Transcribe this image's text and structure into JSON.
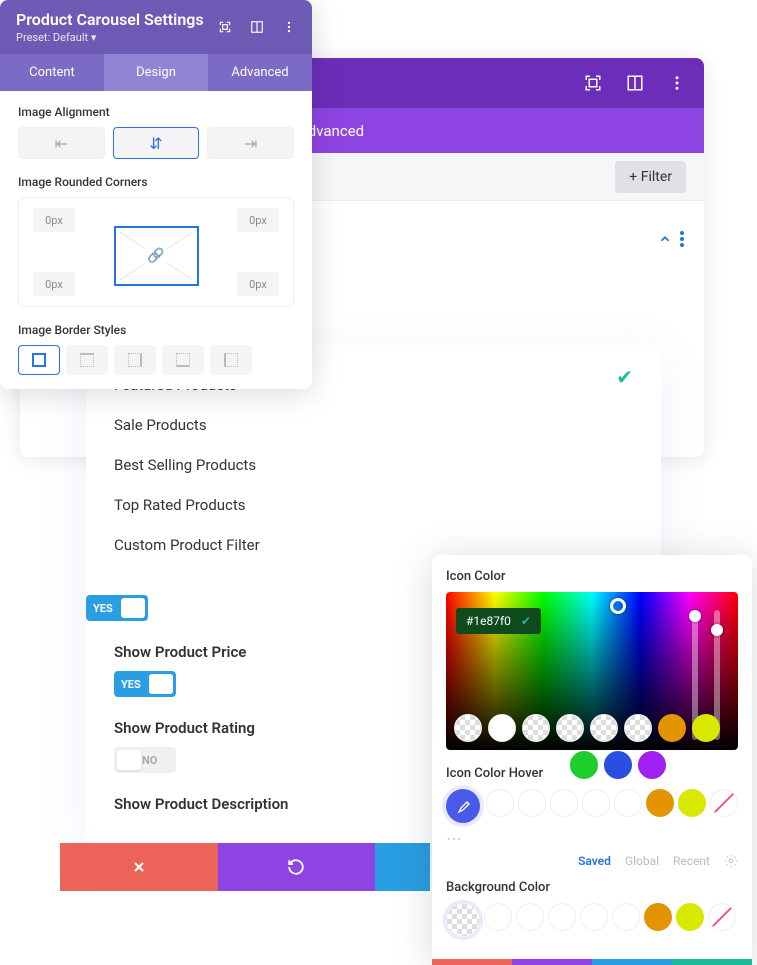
{
  "front": {
    "title": "Product Carousel Settings",
    "preset": "Preset: Default",
    "tabs": [
      "Content",
      "Design",
      "Advanced"
    ],
    "sections": {
      "alignment": "Image Alignment",
      "corners": "Image Rounded Corners",
      "borders": "Image Border Styles"
    },
    "corner_val": "0px"
  },
  "bg": {
    "tab_visible": "Advanced",
    "filter": "Filter"
  },
  "mid": {
    "items": [
      "Featured Products",
      "Sale Products",
      "Best Selling Products",
      "Top Rated Products",
      "Custom Product Filter"
    ],
    "toggles": {
      "price": {
        "label": "Show Product Price",
        "on": "YES"
      },
      "rating": {
        "label": "Show Product Rating",
        "off": "NO"
      },
      "desc": {
        "label": "Show Product Description"
      }
    },
    "yes": "YES",
    "no": "NO"
  },
  "cp": {
    "icon_color": "Icon Color",
    "icon_color_hover": "Icon Color Hover",
    "bg_color": "Background Color",
    "hex": "#1e87f0",
    "tabs": [
      "Saved",
      "Global",
      "Recent"
    ]
  }
}
